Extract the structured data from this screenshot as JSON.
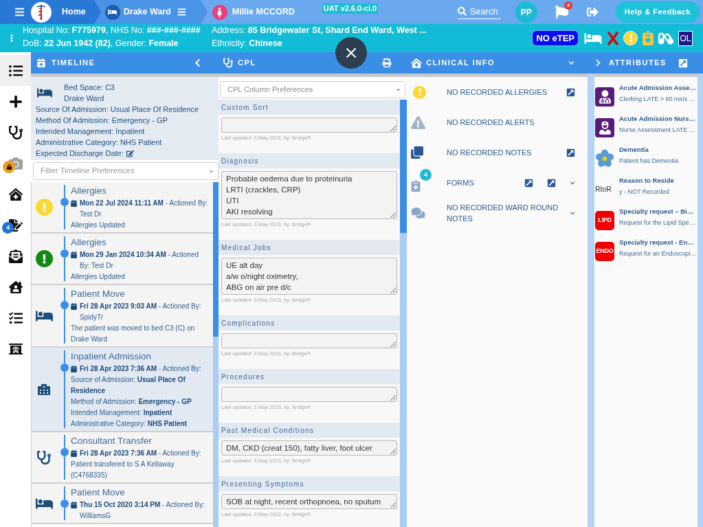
{
  "top_bar": {
    "breadcrumbs": [
      {
        "kind": "home",
        "label": "Home"
      },
      {
        "kind": "ward",
        "label": "Drake Ward"
      },
      {
        "kind": "patient",
        "label": "Millie MCCORD"
      }
    ],
    "environment": "UAT v2.6.0-ci.0",
    "search": "Search",
    "user_initials": "PP",
    "notification_count": "4",
    "help_button": "Help & Feedback"
  },
  "patient_banner": {
    "details": [
      "Hospital No: **F775979**, NHS No: **###-###-####**",
      "Address: **85 Bridgewater St, Shard End Ward, West ...**",
      "DoB: **22 Jun 1942 (82)**, Gender: **Female**",
      "Ethnicity: **Chinese**"
    ],
    "tags": [
      {
        "kind": "etep",
        "label": "NO eTEP"
      },
      {
        "kind": "bed"
      },
      {
        "kind": "cross"
      },
      {
        "kind": "alert"
      },
      {
        "kind": "clipboard"
      },
      {
        "kind": "pill"
      },
      {
        "kind": "initials",
        "label": "OL"
      }
    ]
  },
  "sidebar": {
    "items": [
      {
        "selected": true,
        "locked": false
      },
      {
        "selected": false,
        "locked": false
      },
      {
        "selected": false,
        "locked": false
      },
      {
        "selected": false,
        "locked": true
      },
      {
        "selected": false,
        "locked": false
      },
      {
        "selected": false,
        "locked": false,
        "badge": "4"
      },
      {
        "selected": false,
        "locked": false
      },
      {
        "selected": false,
        "locked": false
      },
      {
        "selected": false,
        "locked": false
      },
      {
        "selected": false,
        "locked": false
      }
    ]
  },
  "timeline": {
    "title": "TIMELINE",
    "bed_space": "Bed Space: C3",
    "ward": "Drake Ward",
    "details": [
      "Source Of Admission: Usual Place Of Residence",
      "Method Of Admission: Emergency - GP",
      "Intended Management: Inpatient",
      "Administrative Category: NHS Patient"
    ],
    "discharge_label": "Expected Discharge Date:",
    "filter": {
      "placeholder": "Filter Timeline Preferences"
    },
    "events": [
      {
        "kind": "allergy",
        "color": "#fdd835",
        "selected": false,
        "title": "Allergies",
        "date_line": "**Mon 22 Jul 2024 11:11 AM** - Actioned By: Test Dr",
        "details": [
          "Allergies Updated"
        ]
      },
      {
        "kind": "allergy",
        "color": "#128a12",
        "selected": false,
        "title": "Allergies",
        "date_line": "**Mon 29 Jan 2024 10:34 AM** - Actioned By: Test Dr",
        "details": [
          "Allergies Updated"
        ]
      },
      {
        "kind": "bed",
        "selected": false,
        "title": "Patient Move",
        "date_line": "**Fri 28 Apr 2023 9:03 AM** - Actioned By: SpidyTr",
        "details": [
          "The patient was moved to bed C3 (C) on Drake Ward"
        ]
      },
      {
        "kind": "admission",
        "selected": true,
        "title": "Inpatient Admission",
        "date_line": "**Fri 28 Apr 2023 7:36 AM** - Actioned By:",
        "details": [
          "Source of Admission: **Usual Place Of Residence**",
          "Method of Admission: **Emergency - GP**",
          "Intended Management: **Inpatient**",
          "Administrative Category: **NHS Patient**"
        ]
      },
      {
        "kind": "consultant",
        "selected": false,
        "title": "Consultant Transfer",
        "date_line": "**Fri 28 Apr 2023 7:36 AM** - Actioned By:",
        "details": [
          "Patient transfered to S A Kellaway (C4768335)"
        ]
      },
      {
        "kind": "bed",
        "selected": false,
        "title": "Patient Move",
        "date_line": "**Thu 15 Oct 2020 3:14 PM** - Actioned By: WilliamsG"
      }
    ]
  },
  "cpl": {
    "title": "CPL",
    "preferences": {
      "placeholder": "CPL Column Preferences"
    },
    "sections": [
      {
        "heading": "Custom Sort",
        "updated": "Last updated: 3 May 2023, by: BridgeR"
      },
      {
        "heading": "Diagnosis",
        "value": "Probable oedema due to proteinuria\nLRTI (crackles, CRP)\nUTI\nAKI resolving",
        "updated": "Last updated: 3 May 2023, by: BridgeR"
      },
      {
        "heading": "Medical Jobs",
        "value": "UE alt day\na/w o/night oximetry,\nABG on air pre d/c",
        "updated": "Last updated: 3 May 2023, by: BridgeR"
      },
      {
        "heading": "Complications",
        "updated": "Last updated: 3 May 2023, by: BridgeR"
      },
      {
        "heading": "Procedures",
        "updated": "Last updated: 3 May 2023, by: BridgeR"
      },
      {
        "heading": "Past Medical Conditions",
        "value": "DM, CKD (creat 150), fatty liver, foot ulcer",
        "updated": "Last updated: 3 May 2023, by: BridgeR"
      },
      {
        "heading": "Presenting Symptoms",
        "value": "SOB at night, recent orthopnoea, no sputum",
        "updated": "Last updated: 3 May 2023, by: BridgeR"
      }
    ]
  },
  "clinical_info": {
    "title": "CLINICAL INFO",
    "items": [
      {
        "kind": "allergies",
        "label": "NO RECORDED ALLERGIES"
      },
      {
        "kind": "alerts",
        "label": "NO RECORDED ALERTS"
      },
      {
        "kind": "notes",
        "label": "NO RECORDED NOTES"
      },
      {
        "kind": "forms",
        "label": "FORMS",
        "badge": "4"
      },
      {
        "kind": "ward_round",
        "label": "NO RECORDED WARD ROUND NOTES"
      }
    ]
  },
  "attributes": {
    "title": "ATTRIBUTES",
    "items": [
      {
        "kind": "doctor",
        "title": "Acute Admission Asse…",
        "subtitle": "Clerking LATE > 60 mins …"
      },
      {
        "kind": "nurse",
        "title": "Acute Admission Nurs…",
        "subtitle": "Nurse Assessment LATE …"
      },
      {
        "kind": "flower",
        "title": "Dementia",
        "subtitle": "Patient has Dementia"
      },
      {
        "kind": "code",
        "code": "RtoR",
        "title": "Reason to Reside",
        "subtitle": "y - NOT Recorded"
      },
      {
        "kind": "tag",
        "code": "LIPD",
        "title": "Specialty request – Bi…",
        "subtitle": "Request for the Lipid Spe…"
      },
      {
        "kind": "tag",
        "code": "ENDO",
        "title": "Specialty request - En…",
        "subtitle": "Request for an Endoscopi…"
      }
    ]
  }
}
